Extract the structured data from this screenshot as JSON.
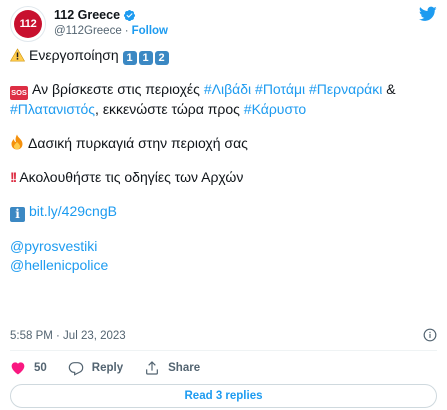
{
  "author": {
    "display_name": "112 Greece",
    "handle": "@112Greece",
    "separator": "·",
    "follow_label": "Follow",
    "avatar_text": "112"
  },
  "tweet": {
    "line1_text": "Ενεργοποίηση",
    "keycaps": [
      "1",
      "1",
      "2"
    ],
    "sos_label": "SOS",
    "line2_prefix": "Αν βρίσκεστε στις περιοχές",
    "hashtags": [
      "#Λιβάδι",
      "#Ποτάμι",
      "#Περναράκι",
      "#Πλατανιστός"
    ],
    "amp": "&",
    "line2_suffix": "εκκενώστε τώρα προς",
    "hashtag_dest": "#Κάρυστο",
    "line3_text": "Δασική πυρκαγιά στην περιοχή σας",
    "bang": "!!",
    "line4_text": "Ακολουθήστε τις οδηγίες των Αρχών",
    "info_glyph": "i",
    "link": "bit.ly/429cngB",
    "mentions": [
      "@pyrosvestiki",
      "@hellenicpolice"
    ]
  },
  "meta": {
    "timestamp": "5:58 PM · Jul 23, 2023"
  },
  "actions": {
    "like_count": "50",
    "reply_label": "Reply",
    "share_label": "Share"
  },
  "read_replies_label": "Read 3 replies",
  "colors": {
    "accent": "#1d9bf0",
    "text": "#0f1419",
    "muted": "#536471",
    "like": "#f91880",
    "brand_red": "#c8102e"
  }
}
